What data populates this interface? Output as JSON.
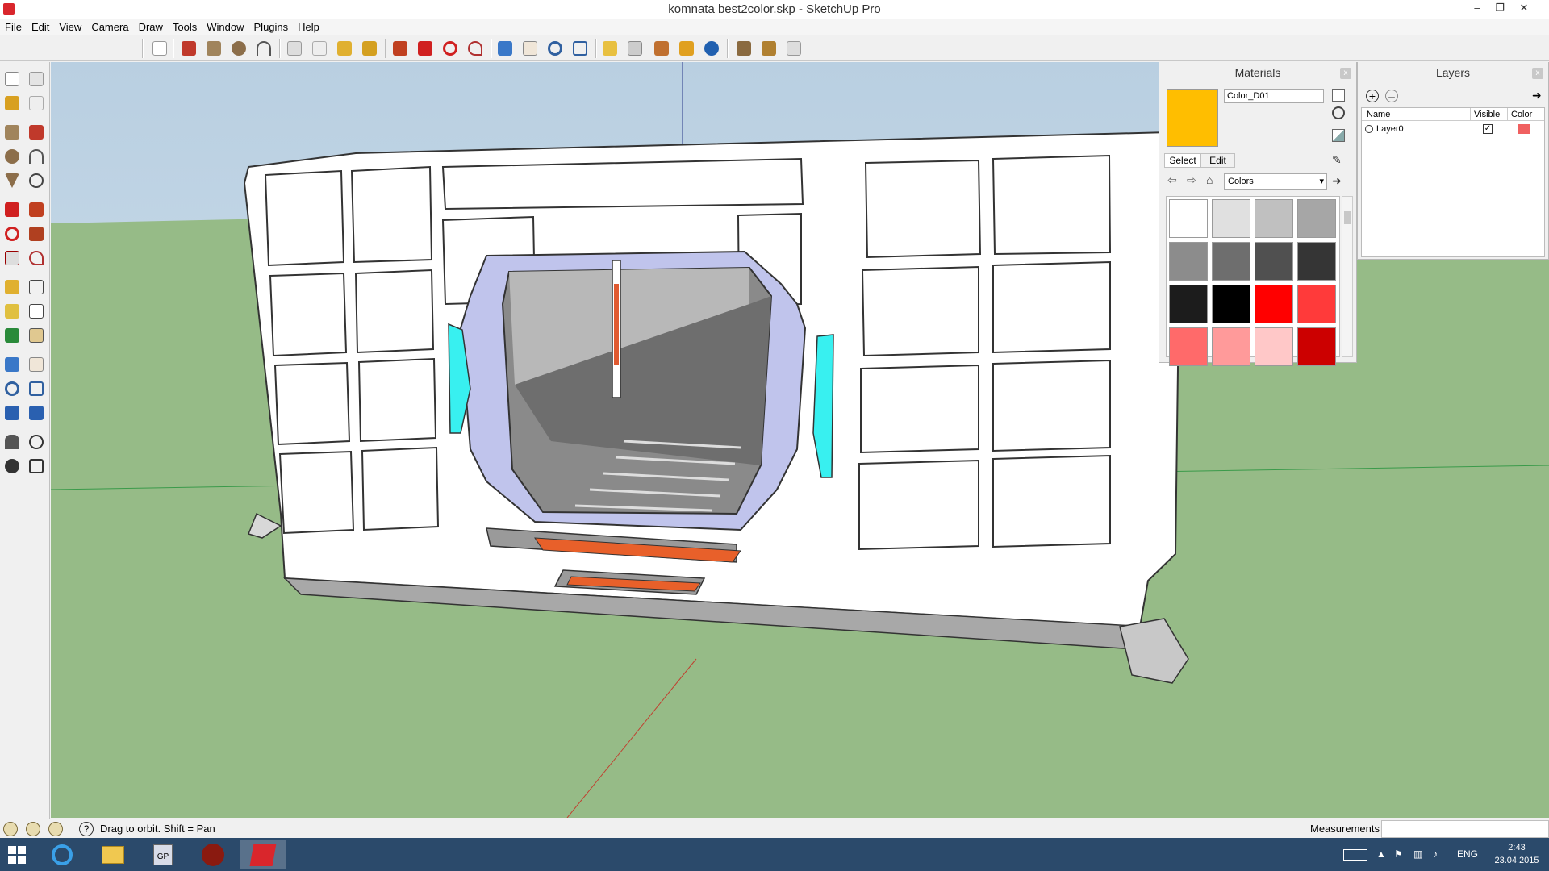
{
  "window": {
    "title": "komnata best2color.skp - SketchUp Pro",
    "minimize_glyph": "–",
    "restore_glyph": "❐",
    "close_glyph": "✕"
  },
  "menu": [
    "File",
    "Edit",
    "View",
    "Camera",
    "Draw",
    "Tools",
    "Window",
    "Plugins",
    "Help"
  ],
  "materials": {
    "title": "Materials",
    "close_glyph": "x",
    "current_name": "Color_D01",
    "current_color": "#ffbe00",
    "tabs": [
      "Select",
      "Edit"
    ],
    "collection": "Colors",
    "swatches": [
      [
        "#ffffff",
        "#e0e0e0",
        "#c0c0c0",
        "#a6a6a6"
      ],
      [
        "#8c8c8c",
        "#6e6e6e",
        "#505050",
        "#353535"
      ],
      [
        "#1c1c1c",
        "#000000",
        "#ff0000",
        "#ff3a3a"
      ],
      [
        "#ff6a6a",
        "#ff9a9a",
        "#ffc8c8",
        "#cc0000"
      ]
    ]
  },
  "layers": {
    "title": "Layers",
    "close_glyph": "x",
    "columns": [
      "Name",
      "Visible",
      "Color"
    ],
    "rows": [
      {
        "name": "Layer0",
        "visible": true,
        "color": "#f06060"
      }
    ]
  },
  "status": {
    "hint": "Drag to orbit.  Shift = Pan",
    "measurements_label": "Measurements",
    "measurements_value": ""
  },
  "taskbar": {
    "language": "ENG",
    "time": "2:43",
    "date": "23.04.2015"
  }
}
